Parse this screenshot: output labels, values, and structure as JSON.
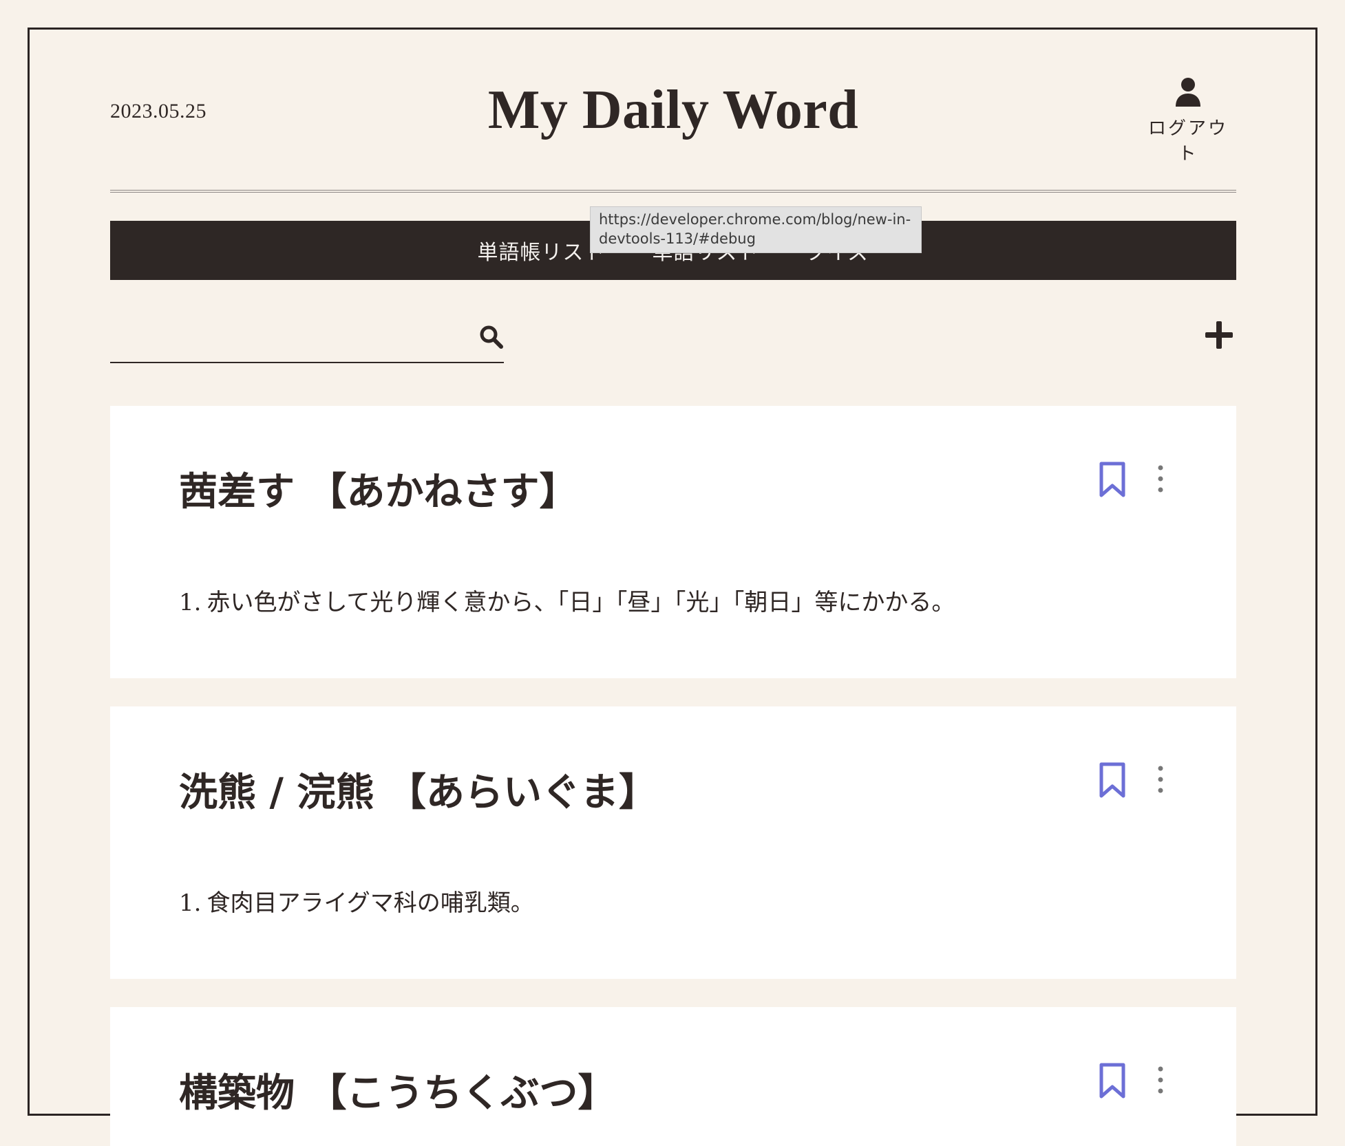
{
  "header": {
    "date": "2023.05.25",
    "title": "My Daily Word",
    "logout_label": "ログアウト"
  },
  "nav": {
    "items": [
      {
        "label": "単語帳リスト"
      },
      {
        "label": "単語リスト"
      },
      {
        "label": "クイズ"
      }
    ]
  },
  "tooltip": {
    "text": "https://developer.chrome.com/blog/new-in-devtools-113/#debug"
  },
  "search": {
    "value": "",
    "placeholder": ""
  },
  "icons": {
    "user": "user-icon",
    "search": "search-icon",
    "add": "plus-icon",
    "bookmark": "bookmark-icon",
    "more": "more-vertical-icon"
  },
  "colors": {
    "background": "#f8f2ea",
    "nav_bg": "#2e2725",
    "text": "#2f2725",
    "bookmark": "#6c6fd6",
    "card_bg": "#ffffff"
  },
  "words": [
    {
      "title": "茜差す 【あかねさす】",
      "meanings": [
        {
          "number": "1.",
          "text": "赤い色がさして光り輝く意から、「日」「昼」「光」「朝日」等にかかる。"
        }
      ]
    },
    {
      "title": "洗熊 / 浣熊 【あらいぐま】",
      "meanings": [
        {
          "number": "1.",
          "text": "食肉目アライグマ科の哺乳類。"
        }
      ]
    },
    {
      "title": "構築物 【こうちくぶつ】",
      "meanings": []
    }
  ]
}
